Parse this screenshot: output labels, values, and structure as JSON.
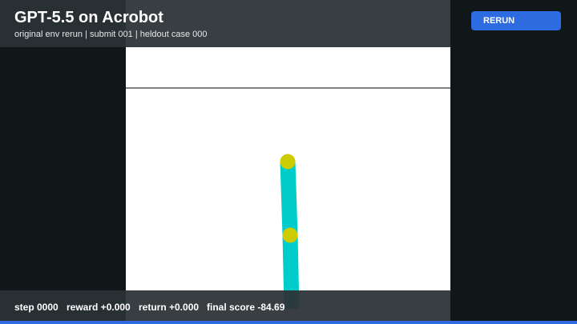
{
  "header": {
    "title": "GPT-5.5 on Acrobot",
    "subtitle": "original env rerun | submit 001 | heldout case 000"
  },
  "controls": {
    "rerun_label": "RERUN"
  },
  "status": {
    "step": "step 0000",
    "reward": "reward +0.000",
    "return": "return +0.000",
    "final_score": "final score -84.69"
  },
  "colors": {
    "link": "#00cccc",
    "joint": "#cccc00",
    "target_line": "#000000",
    "accent": "#2f6be0"
  }
}
